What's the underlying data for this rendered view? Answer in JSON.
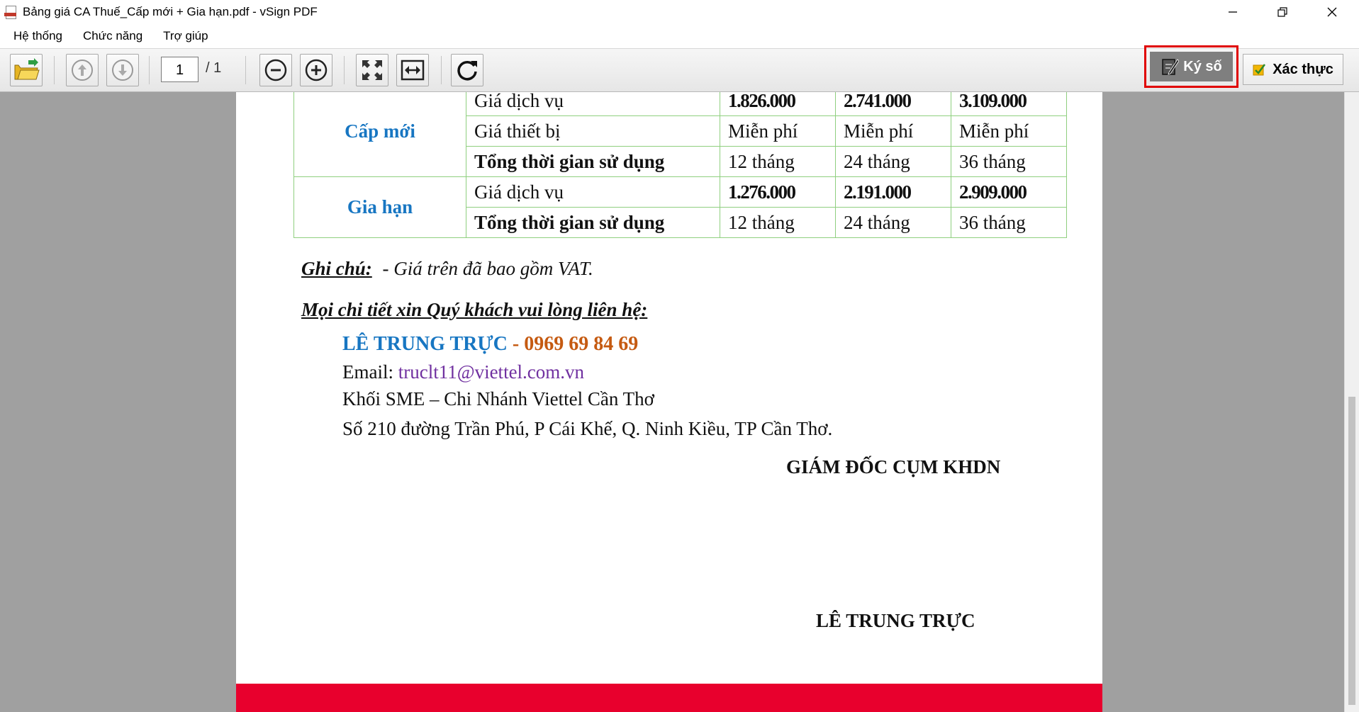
{
  "window": {
    "title": "Bảng giá CA Thuế_Cấp mới + Gia hạn.pdf - vSign PDF"
  },
  "menu": {
    "items": [
      "Hệ thống",
      "Chức năng",
      "Trợ giúp"
    ]
  },
  "toolbar": {
    "page_current": "1",
    "page_total": "/ 1",
    "sign_label": "Ký số",
    "verify_label": "Xác thực",
    "icons": [
      "open-folder-icon",
      "arrow-up-icon",
      "arrow-down-icon",
      "zoom-out-icon",
      "zoom-in-icon",
      "fit-page-icon",
      "fit-width-icon",
      "rotate-icon"
    ],
    "highlight_color": "#e00000"
  },
  "document": {
    "table": {
      "rows": [
        {
          "group": "Cấp mới",
          "label": "Giá dịch vụ",
          "v1": "1.826.000",
          "v2": "2.741.000",
          "v3": "3.109.000"
        },
        {
          "label": "Giá thiết bị",
          "v1": "Miễn phí",
          "v2": "Miễn phí",
          "v3": "Miễn phí"
        },
        {
          "label": "Tổng thời gian sử dụng",
          "v1": "12 tháng",
          "v2": "24  tháng",
          "v3": "36  tháng"
        },
        {
          "group": "Gia hạn",
          "label": "Giá dịch vụ",
          "v1": "1.276.000",
          "v2": "2.191.000",
          "v3": "2.909.000"
        },
        {
          "label": "Tổng thời gian sử dụng",
          "v1": "12  tháng",
          "v2": "24  tháng",
          "v3": "36  tháng"
        }
      ]
    },
    "note_label": "Ghi chú:",
    "note_text": "-  Giá trên đã bao gồm VAT.",
    "contact_heading": "Mọi chi tiết xin Quý khách vui lòng liên hệ:",
    "contact_name": "LÊ TRUNG TRỰC",
    "contact_dash": " - ",
    "contact_phone": "0969 69 84 69",
    "email_label": "Email: ",
    "email": "truclt11@viettel.com.vn",
    "branch": "Khối SME – Chi Nhánh Viettel Cần Thơ",
    "address": "Số 210 đường Trần Phú, P Cái Khế, Q. Ninh Kiều, TP Cần Thơ.",
    "signer_title": "GIÁM ĐỐC CỤM KHDN",
    "signer_name": "LÊ TRUNG TRỰC",
    "colors": {
      "group_label": "#1776c2",
      "contact_name": "#1776c2",
      "phone": "#c55a11",
      "email": "#7030a0",
      "footer_band": "#e8002d"
    }
  }
}
